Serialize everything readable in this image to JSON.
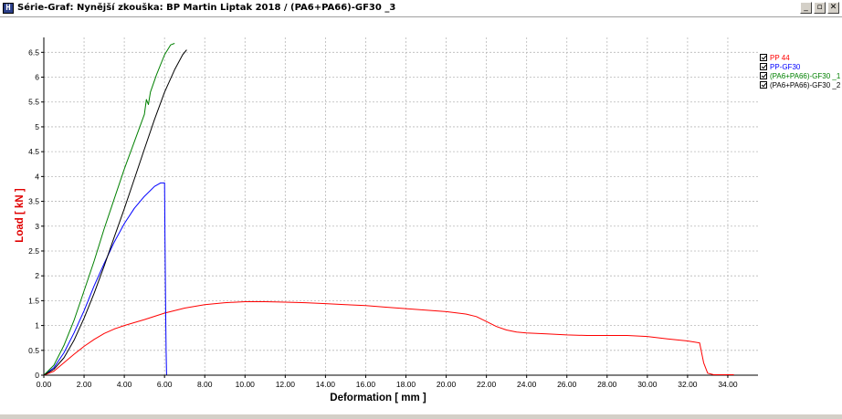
{
  "window": {
    "title": "Série-Graf:  Nynější zkouška: BP Martin Liptak 2018 / (PA6+PA66)-GF30 _3",
    "icon_name": "app-logo-icon",
    "buttons": {
      "minimize": "_",
      "restore": "▫",
      "close": "✕"
    }
  },
  "chart_data": {
    "type": "line",
    "xlabel": "Deformation [ mm ]",
    "ylabel": "Load [ kN ]",
    "xlim": [
      0,
      35.5
    ],
    "ylim": [
      0,
      6.8
    ],
    "xticks": [
      "0.00",
      "2.00",
      "4.00",
      "6.00",
      "8.00",
      "10.00",
      "12.00",
      "14.00",
      "16.00",
      "18.00",
      "20.00",
      "22.00",
      "24.00",
      "26.00",
      "28.00",
      "30.00",
      "32.00",
      "34.00"
    ],
    "yticks": [
      "0",
      "0.5",
      "1",
      "1.5",
      "2",
      "2.5",
      "3",
      "3.5",
      "4",
      "4.5",
      "5",
      "5.5",
      "6",
      "6.5"
    ],
    "grid": true,
    "legend_position": "right",
    "series": [
      {
        "name": "PP 44",
        "color": "#ff0000",
        "points": [
          [
            0,
            0
          ],
          [
            0.5,
            0.08
          ],
          [
            1,
            0.25
          ],
          [
            1.5,
            0.42
          ],
          [
            2,
            0.58
          ],
          [
            2.5,
            0.72
          ],
          [
            3,
            0.84
          ],
          [
            3.5,
            0.93
          ],
          [
            4,
            1.0
          ],
          [
            5,
            1.12
          ],
          [
            6,
            1.25
          ],
          [
            7,
            1.35
          ],
          [
            8,
            1.42
          ],
          [
            9,
            1.46
          ],
          [
            10,
            1.48
          ],
          [
            11,
            1.48
          ],
          [
            12,
            1.47
          ],
          [
            13,
            1.46
          ],
          [
            14,
            1.44
          ],
          [
            15,
            1.42
          ],
          [
            16,
            1.4
          ],
          [
            17,
            1.37
          ],
          [
            18,
            1.34
          ],
          [
            19,
            1.31
          ],
          [
            20,
            1.28
          ],
          [
            21,
            1.23
          ],
          [
            21.5,
            1.18
          ],
          [
            22,
            1.08
          ],
          [
            22.5,
            0.98
          ],
          [
            23,
            0.91
          ],
          [
            23.5,
            0.87
          ],
          [
            24,
            0.85
          ],
          [
            25,
            0.83
          ],
          [
            26,
            0.81
          ],
          [
            27,
            0.8
          ],
          [
            28,
            0.8
          ],
          [
            29,
            0.8
          ],
          [
            30,
            0.78
          ],
          [
            31,
            0.73
          ],
          [
            32,
            0.69
          ],
          [
            32.6,
            0.65
          ],
          [
            32.8,
            0.25
          ],
          [
            33,
            0.04
          ],
          [
            33.3,
            0.01
          ],
          [
            34.3,
            0.01
          ]
        ]
      },
      {
        "name": "PP-GF30",
        "color": "#0000ff",
        "points": [
          [
            0,
            0
          ],
          [
            0.5,
            0.15
          ],
          [
            1,
            0.45
          ],
          [
            1.5,
            0.85
          ],
          [
            2,
            1.3
          ],
          [
            2.5,
            1.8
          ],
          [
            3,
            2.25
          ],
          [
            3.5,
            2.68
          ],
          [
            4,
            3.05
          ],
          [
            4.5,
            3.36
          ],
          [
            5,
            3.6
          ],
          [
            5.5,
            3.8
          ],
          [
            5.8,
            3.87
          ],
          [
            6.0,
            3.87
          ],
          [
            6.02,
            2.9
          ],
          [
            6.05,
            1.5
          ],
          [
            6.08,
            0.5
          ],
          [
            6.1,
            0.01
          ]
        ]
      },
      {
        "name": "(PA6+PA66)-GF30 _1",
        "color": "#008000",
        "points": [
          [
            0,
            0
          ],
          [
            0.5,
            0.2
          ],
          [
            1,
            0.6
          ],
          [
            1.5,
            1.1
          ],
          [
            2,
            1.7
          ],
          [
            2.5,
            2.3
          ],
          [
            3,
            2.95
          ],
          [
            3.5,
            3.55
          ],
          [
            4,
            4.15
          ],
          [
            4.5,
            4.7
          ],
          [
            5,
            5.25
          ],
          [
            5.1,
            5.55
          ],
          [
            5.2,
            5.45
          ],
          [
            5.3,
            5.7
          ],
          [
            5.6,
            6.05
          ],
          [
            6,
            6.45
          ],
          [
            6.3,
            6.65
          ],
          [
            6.5,
            6.68
          ]
        ]
      },
      {
        "name": "(PA6+PA66)-GF30 _2",
        "color": "#000000",
        "points": [
          [
            0,
            0
          ],
          [
            0.5,
            0.12
          ],
          [
            1,
            0.35
          ],
          [
            1.5,
            0.7
          ],
          [
            2,
            1.15
          ],
          [
            2.5,
            1.65
          ],
          [
            3,
            2.2
          ],
          [
            3.5,
            2.78
          ],
          [
            4,
            3.35
          ],
          [
            4.5,
            3.95
          ],
          [
            5,
            4.55
          ],
          [
            5.5,
            5.15
          ],
          [
            6,
            5.7
          ],
          [
            6.5,
            6.15
          ],
          [
            6.9,
            6.45
          ],
          [
            7.1,
            6.55
          ]
        ]
      }
    ]
  }
}
